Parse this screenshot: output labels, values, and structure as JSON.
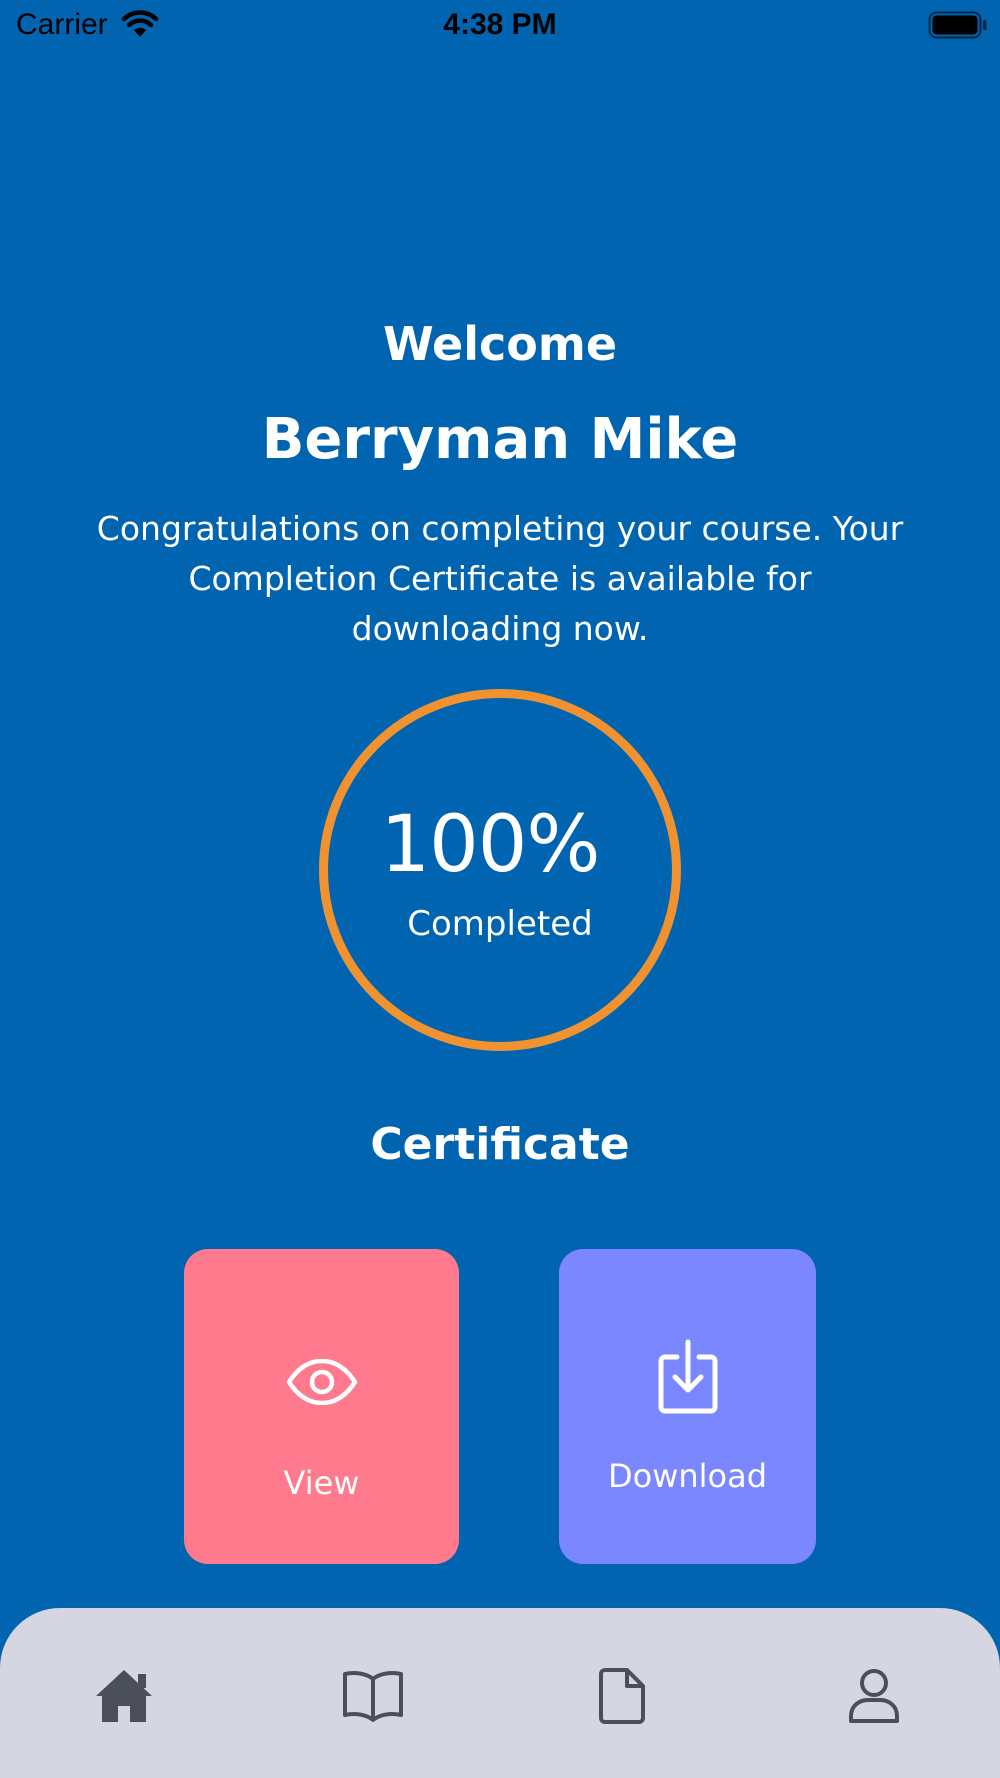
{
  "status_bar": {
    "carrier": "Carrier",
    "time": "4:38 PM",
    "icons": [
      "wifi-icon",
      "battery-icon"
    ]
  },
  "main": {
    "welcome": "Welcome",
    "user_name": "Berryman Mike",
    "message": "Congratulations on completing your course. Your Completion Certificate is available for downloading now.",
    "progress": {
      "value": "100%",
      "label": "Completed",
      "fraction": 1.0,
      "ring_color": "#f0922f"
    },
    "certificate": {
      "heading": "Certificate",
      "actions": [
        {
          "label": "View",
          "icon": "eye-icon",
          "color": "#ff7a8c"
        },
        {
          "label": "Download",
          "icon": "download-icon",
          "color": "#7b87ff"
        }
      ]
    }
  },
  "tab_bar": {
    "tabs": [
      {
        "icon": "home-icon"
      },
      {
        "icon": "book-icon"
      },
      {
        "icon": "document-icon"
      },
      {
        "icon": "profile-icon"
      }
    ]
  },
  "colors": {
    "background": "#0064b0",
    "tab_bar": "#d6d6e2",
    "tab_icon": "#4a4f59"
  }
}
